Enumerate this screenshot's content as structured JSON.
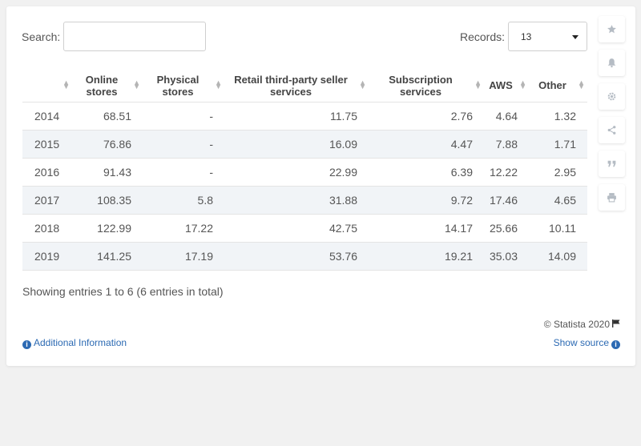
{
  "search": {
    "label": "Search:",
    "value": "",
    "placeholder": ""
  },
  "records": {
    "label": "Records:",
    "value": "13"
  },
  "table": {
    "headers": [
      "",
      "Online stores",
      "Physical stores",
      "Retail third-party seller services",
      "Subscription services",
      "AWS",
      "Other"
    ],
    "rows": [
      [
        "2014",
        "68.51",
        "-",
        "11.75",
        "2.76",
        "4.64",
        "1.32"
      ],
      [
        "2015",
        "76.86",
        "-",
        "16.09",
        "4.47",
        "7.88",
        "1.71"
      ],
      [
        "2016",
        "91.43",
        "-",
        "22.99",
        "6.39",
        "12.22",
        "2.95"
      ],
      [
        "2017",
        "108.35",
        "5.8",
        "31.88",
        "9.72",
        "17.46",
        "4.65"
      ],
      [
        "2018",
        "122.99",
        "17.22",
        "42.75",
        "14.17",
        "25.66",
        "10.11"
      ],
      [
        "2019",
        "141.25",
        "17.19",
        "53.76",
        "19.21",
        "35.03",
        "14.09"
      ]
    ]
  },
  "footer": {
    "showing": "Showing entries 1 to 6 (6 entries in total)",
    "copyright": "© Statista 2020",
    "additional_info": "Additional Information",
    "show_source": "Show source"
  },
  "sidebar_icons": [
    "star-icon",
    "bell-icon",
    "gear-icon",
    "share-icon",
    "quote-icon",
    "print-icon"
  ],
  "colors": {
    "link": "#2c6ab3",
    "row_shade": "#f1f4f7",
    "icon": "#b5bcc4"
  }
}
